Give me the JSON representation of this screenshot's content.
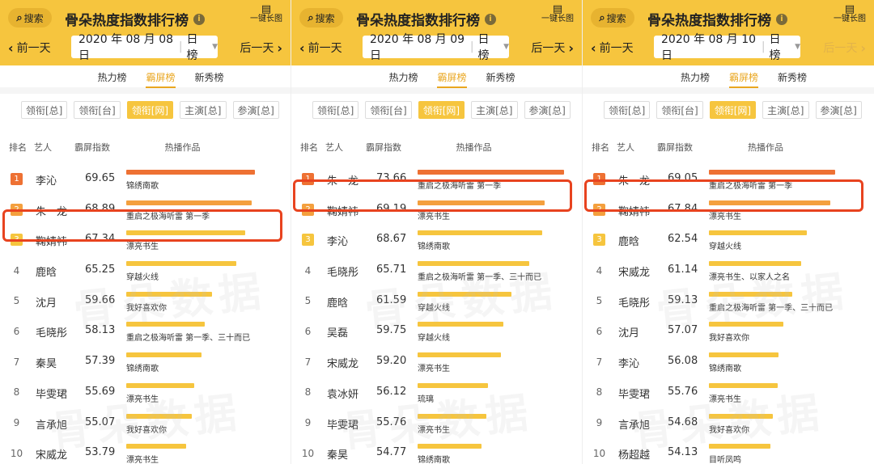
{
  "header": {
    "search_label": "搜索",
    "title": "骨朵热度指数排行榜",
    "long_image_label": "一键长图",
    "prev_label": "前一天",
    "next_label": "后一天",
    "period_label": "日榜"
  },
  "tabs": [
    {
      "label": "热力榜",
      "active": false
    },
    {
      "label": "霸屏榜",
      "active": true
    },
    {
      "label": "新秀榜",
      "active": false
    }
  ],
  "filters": [
    {
      "label": "领衔[总]",
      "active": false
    },
    {
      "label": "领衔[台]",
      "active": false
    },
    {
      "label": "领衔[网]",
      "active": true
    },
    {
      "label": "主演[总]",
      "active": false
    },
    {
      "label": "参演[总]",
      "active": false
    }
  ],
  "columns": {
    "rank": "排名",
    "artist": "艺人",
    "index": "霸屏指数",
    "works": "热播作品"
  },
  "watermark": "骨朵数据",
  "colors": {
    "header_bg": "#f6c53e",
    "accent": "#e9a61f",
    "rank1": "#ee7133",
    "rank2": "#f4a03e",
    "highlight": "#e8431f"
  },
  "panels": [
    {
      "date": "2020 年 08 月 08 日",
      "next_disabled": false,
      "highlight_rank": 3,
      "rows": [
        {
          "rank": "1",
          "artist": "李沁",
          "index": "69.65",
          "value": 69.65,
          "work": "锦绣南歌"
        },
        {
          "rank": "2",
          "artist": "朱一龙",
          "index": "68.89",
          "value": 68.89,
          "work": "重启之极海听雷 第一季"
        },
        {
          "rank": "3",
          "artist": "鞠婧祎",
          "index": "67.34",
          "value": 67.34,
          "work": "漂亮书生"
        },
        {
          "rank": "4",
          "artist": "鹿晗",
          "index": "65.25",
          "value": 65.25,
          "work": "穿越火线"
        },
        {
          "rank": "5",
          "artist": "沈月",
          "index": "59.66",
          "value": 59.66,
          "work": "我好喜欢你"
        },
        {
          "rank": "6",
          "artist": "毛晓彤",
          "index": "58.13",
          "value": 58.13,
          "work": "重启之极海听雷 第一季、三十而已"
        },
        {
          "rank": "7",
          "artist": "秦昊",
          "index": "57.39",
          "value": 57.39,
          "work": "锦绣南歌"
        },
        {
          "rank": "8",
          "artist": "毕雯珺",
          "index": "55.69",
          "value": 55.69,
          "work": "漂亮书生"
        },
        {
          "rank": "9",
          "artist": "言承旭",
          "index": "55.07",
          "value": 55.07,
          "work": "我好喜欢你"
        },
        {
          "rank": "10",
          "artist": "宋威龙",
          "index": "53.79",
          "value": 53.79,
          "work": "漂亮书生"
        }
      ]
    },
    {
      "date": "2020 年 08 月 09 日",
      "next_disabled": false,
      "highlight_rank": 2,
      "rows": [
        {
          "rank": "1",
          "artist": "朱一龙",
          "index": "73.66",
          "value": 73.66,
          "work": "重启之极海听雷 第一季"
        },
        {
          "rank": "2",
          "artist": "鞠婧祎",
          "index": "69.19",
          "value": 69.19,
          "work": "漂亮书生"
        },
        {
          "rank": "3",
          "artist": "李沁",
          "index": "68.67",
          "value": 68.67,
          "work": "锦绣南歌"
        },
        {
          "rank": "4",
          "artist": "毛晓彤",
          "index": "65.71",
          "value": 65.71,
          "work": "重启之极海听雷 第一季、三十而已"
        },
        {
          "rank": "5",
          "artist": "鹿晗",
          "index": "61.59",
          "value": 61.59,
          "work": "穿越火线"
        },
        {
          "rank": "6",
          "artist": "吴磊",
          "index": "59.75",
          "value": 59.75,
          "work": "穿越火线"
        },
        {
          "rank": "7",
          "artist": "宋威龙",
          "index": "59.20",
          "value": 59.2,
          "work": "漂亮书生"
        },
        {
          "rank": "8",
          "artist": "袁冰妍",
          "index": "56.12",
          "value": 56.12,
          "work": "琉璃"
        },
        {
          "rank": "9",
          "artist": "毕雯珺",
          "index": "55.76",
          "value": 55.76,
          "work": "漂亮书生"
        },
        {
          "rank": "10",
          "artist": "秦昊",
          "index": "54.77",
          "value": 54.77,
          "work": "锦绣南歌"
        }
      ]
    },
    {
      "date": "2020 年 08 月 10 日",
      "next_disabled": true,
      "highlight_rank": 2,
      "rows": [
        {
          "rank": "1",
          "artist": "朱一龙",
          "index": "69.05",
          "value": 69.05,
          "work": "重启之极海听雷 第一季"
        },
        {
          "rank": "2",
          "artist": "鞠婧祎",
          "index": "67.84",
          "value": 67.84,
          "work": "漂亮书生"
        },
        {
          "rank": "3",
          "artist": "鹿晗",
          "index": "62.54",
          "value": 62.54,
          "work": "穿越火线"
        },
        {
          "rank": "4",
          "artist": "宋威龙",
          "index": "61.14",
          "value": 61.14,
          "work": "漂亮书生、以家人之名"
        },
        {
          "rank": "5",
          "artist": "毛晓彤",
          "index": "59.13",
          "value": 59.13,
          "work": "重启之极海听雷 第一季、三十而已"
        },
        {
          "rank": "6",
          "artist": "沈月",
          "index": "57.07",
          "value": 57.07,
          "work": "我好喜欢你"
        },
        {
          "rank": "7",
          "artist": "李沁",
          "index": "56.08",
          "value": 56.08,
          "work": "锦绣南歌"
        },
        {
          "rank": "8",
          "artist": "毕雯珺",
          "index": "55.76",
          "value": 55.76,
          "work": "漂亮书生"
        },
        {
          "rank": "9",
          "artist": "言承旭",
          "index": "54.68",
          "value": 54.68,
          "work": "我好喜欢你"
        },
        {
          "rank": "10",
          "artist": "杨超越",
          "index": "54.13",
          "value": 54.13,
          "work": "目听凤鸣"
        }
      ]
    }
  ]
}
